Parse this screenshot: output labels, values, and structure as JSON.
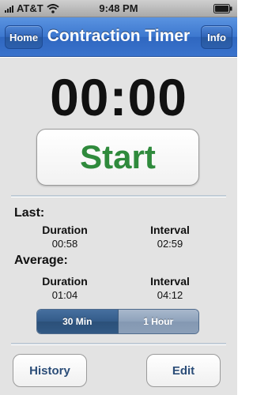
{
  "status_bar": {
    "carrier": "AT&T",
    "time": "9:48 PM"
  },
  "nav": {
    "title": "Contraction Timer",
    "home_label": "Home",
    "info_label": "Info"
  },
  "timer": {
    "display": "00:00",
    "start_label": "Start",
    "start_color": "#2f8a3c"
  },
  "stats": {
    "last": {
      "label": "Last:",
      "duration_label": "Duration",
      "duration_value": "00:58",
      "interval_label": "Interval",
      "interval_value": "02:59"
    },
    "average": {
      "label": "Average:",
      "duration_label": "Duration",
      "duration_value": "01:04",
      "interval_label": "Interval",
      "interval_value": "04:12"
    }
  },
  "range_selector": {
    "options": [
      "30 Min",
      "1 Hour"
    ],
    "selected": "30 Min"
  },
  "bottom": {
    "history_label": "History",
    "edit_label": "Edit"
  },
  "colors": {
    "nav_blue": "#3d78cf",
    "background": "#e3e3e3",
    "link_text": "#2b4d78"
  }
}
